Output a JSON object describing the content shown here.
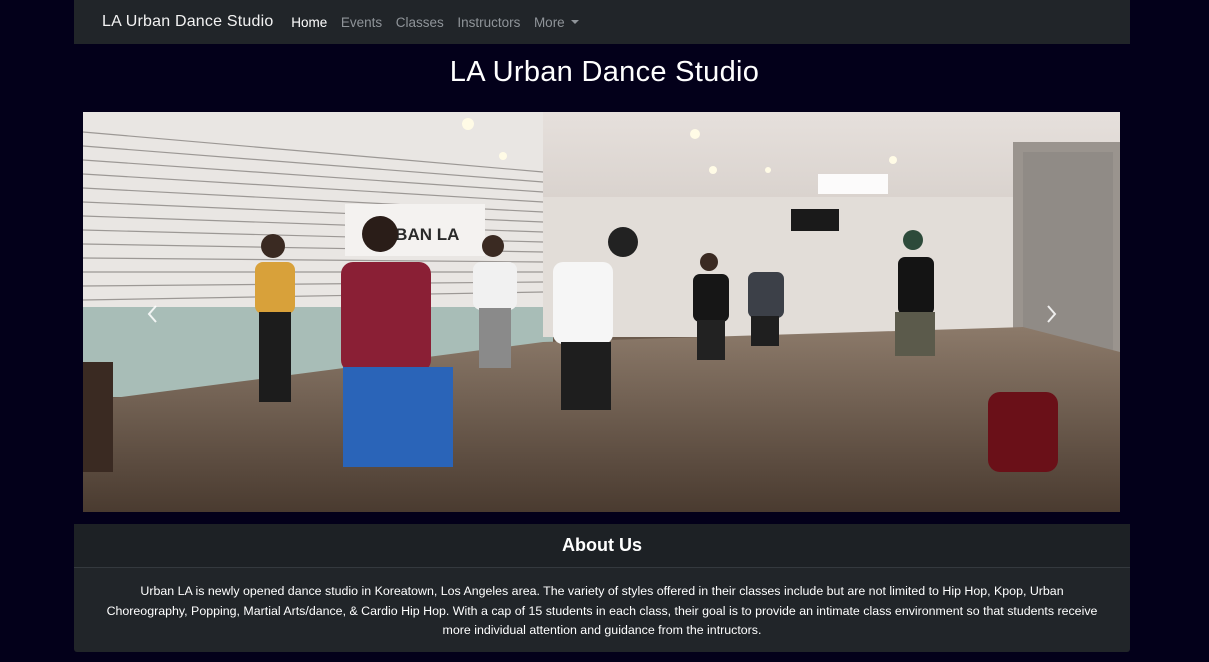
{
  "navbar": {
    "brand": "LA Urban Dance Studio",
    "items": [
      {
        "label": "Home"
      },
      {
        "label": "Events"
      },
      {
        "label": "Classes"
      },
      {
        "label": "Instructors"
      },
      {
        "label": "More"
      }
    ]
  },
  "page_title": "LA Urban Dance Studio",
  "carousel": {
    "wall_sign": "URBAN LA",
    "prev_icon": "chevron-left-icon",
    "next_icon": "chevron-right-icon"
  },
  "about": {
    "heading": "About Us",
    "body": "Urban LA is newly opened dance studio in Koreatown, Los Angeles area. The variety of styles offered in their classes include but are not limited to Hip Hop, Kpop, Urban Choreography, Popping, Martial Arts/dance, & Cardio Hip Hop. With a cap of 15 students in each class, their goal is to provide an intimate class environment so that students receive more individual attention and guidance from the intructors."
  },
  "colors": {
    "page_background": "#03001a",
    "navbar_background": "#212529",
    "card_background": "#212529",
    "active_link": "#ffffff",
    "inactive_link": "#8f9499"
  }
}
